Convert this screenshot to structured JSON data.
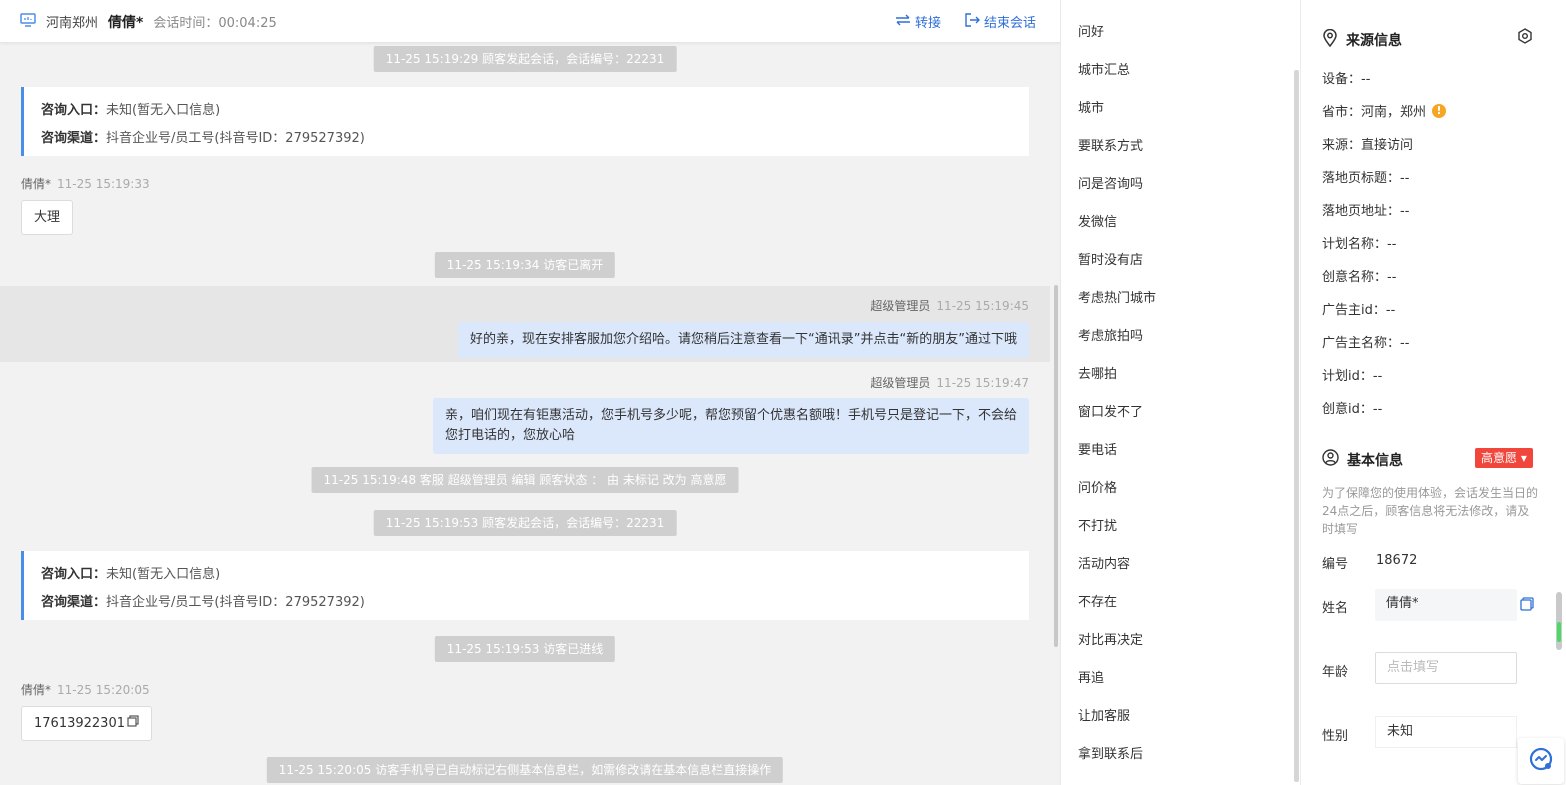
{
  "header": {
    "location": "河南郑州",
    "customer_name": "倩倩*",
    "session_time_label": "会话时间：",
    "session_time": "00:04:25",
    "transfer_label": "转接",
    "end_label": "结束会话"
  },
  "chat": {
    "sys1": "11-25 15:19:29 顾客发起会话，会话编号：22231",
    "entry1": {
      "entry_label": "咨询入口：",
      "entry_value": "未知(暂无入口信息)",
      "channel_label": "咨询渠道：",
      "channel_value": "抖音企业号/员工号(抖音号ID：279527392)"
    },
    "visitor1": {
      "name": "倩倩*",
      "time": "11-25 15:19:33",
      "text": "大理"
    },
    "sys2": "11-25 15:19:34 访客已离开",
    "agent1": {
      "name": "超级管理员",
      "time": "11-25 15:19:45",
      "text": "好的亲，现在安排客服加您介绍哈。请您稍后注意查看一下“通讯录”并点击“新的朋友”通过下哦"
    },
    "agent2": {
      "name": "超级管理员",
      "time": "11-25 15:19:47",
      "text_line1": "亲，咱们现在有钜惠活动，您手机号多少呢，帮您预留个优惠名额哦！手机号只是登记一下，不会给",
      "text_line2": "您打电话的，您放心哈"
    },
    "sys3": "11-25 15:19:48 客服 超级管理员 编辑 顾客状态 ： 由 未标记 改为 高意愿",
    "sys4": "11-25 15:19:53 顾客发起会话，会话编号：22231",
    "entry2": {
      "entry_label": "咨询入口：",
      "entry_value": "未知(暂无入口信息)",
      "channel_label": "咨询渠道：",
      "channel_value": "抖音企业号/员工号(抖音号ID：279527392)"
    },
    "sys5": "11-25 15:19:53 访客已进线",
    "visitor2": {
      "name": "倩倩*",
      "time": "11-25 15:20:05",
      "text": "17613922301"
    },
    "sys6": "11-25 15:20:05 访客手机号已自动标记右侧基本信息栏，如需修改请在基本信息栏直接操作"
  },
  "quick_replies": [
    "问好",
    "城市汇总",
    "城市",
    "要联系方式",
    "问是咨询吗",
    "发微信",
    "暂时没有店",
    "考虑热门城市",
    "考虑旅拍吗",
    "去哪拍",
    "窗口发不了",
    "要电话",
    "问价格",
    "不打扰",
    "活动内容",
    "不存在",
    "对比再决定",
    "再追",
    "让加客服",
    "拿到联系后"
  ],
  "source": {
    "title": "来源信息",
    "rows": [
      {
        "label": "设备：",
        "value": "--"
      },
      {
        "label": "省市：",
        "value": "河南，郑州"
      },
      {
        "label": "来源：",
        "value": "直接访问"
      },
      {
        "label": "落地页标题：",
        "value": "--"
      },
      {
        "label": "落地页地址：",
        "value": "--"
      },
      {
        "label": "计划名称：",
        "value": "--"
      },
      {
        "label": "创意名称：",
        "value": "--"
      },
      {
        "label": "广告主id：",
        "value": "--"
      },
      {
        "label": "广告主名称：",
        "value": "--"
      },
      {
        "label": "计划id：",
        "value": "--"
      },
      {
        "label": "创意id：",
        "value": "--"
      }
    ]
  },
  "basic": {
    "title": "基本信息",
    "intent_badge": "高意愿",
    "notice": "为了保障您的使用体验，会话发生当日的24点之后，顾客信息将无法修改，请及时填写",
    "id_label": "编号",
    "id_value": "18672",
    "name_label": "姓名",
    "name_value": "倩倩*",
    "age_label": "年龄",
    "age_placeholder": "点击填写",
    "gender_label": "性别",
    "gender_value": "未知"
  },
  "colors": {
    "accent": "#2f6fd8",
    "badge": "#f0463c",
    "agent_bubble": "#dbe7fb",
    "warn": "#f5a623"
  }
}
